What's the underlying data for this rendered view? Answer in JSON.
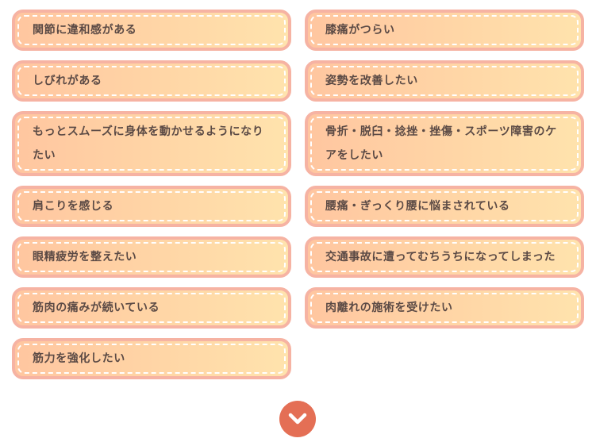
{
  "symptoms": [
    "関節に違和感がある",
    "膝痛がつらい",
    "しびれがある",
    "姿勢を改善したい",
    "もっとスムーズに身体を動かせるようになりたい",
    "骨折・脱臼・捻挫・挫傷・スポーツ障害のケアをしたい",
    "肩こりを感じる",
    "腰痛・ぎっくり腰に悩まされている",
    "眼精疲労を整えたい",
    "交通事故に遭ってむちうちになってしまった",
    "筋肉の痛みが続いている",
    "肉離れの施術を受けたい",
    "筋力を強化したい"
  ],
  "scroll_button": {
    "icon": "chevron-down-icon",
    "color": "#e46f55"
  },
  "colors": {
    "card_border": "#f6b3a3",
    "card_gradient_start": "#ffc6a0",
    "card_gradient_end": "#ffe3ad",
    "text": "#5b4a45"
  }
}
